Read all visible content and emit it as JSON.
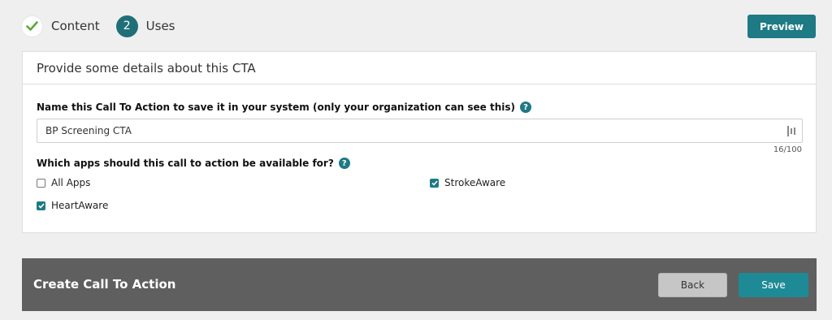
{
  "steps": [
    {
      "label": "Content",
      "state": "done",
      "icon": "check-icon"
    },
    {
      "number": "2",
      "label": "Uses",
      "state": "active"
    }
  ],
  "header": {
    "preview_label": "Preview"
  },
  "card": {
    "title": "Provide some details about this CTA",
    "name_field": {
      "label": "Name this Call To Action to save it in your system (only your organization can see this)",
      "value": "BP Screening CTA",
      "char_count": "16/100"
    },
    "apps_field": {
      "label": "Which apps should this call to action be available for?",
      "options": [
        {
          "label": "All Apps",
          "checked": false
        },
        {
          "label": "StrokeAware",
          "checked": true
        },
        {
          "label": "HeartAware",
          "checked": true
        }
      ]
    },
    "help_glyph": "?"
  },
  "footer": {
    "title": "Create Call To Action",
    "back_label": "Back",
    "save_label": "Save"
  },
  "colors": {
    "accent": "#1e7a84",
    "footer_bg": "#5f5f5f",
    "check_green": "#5aa839"
  }
}
